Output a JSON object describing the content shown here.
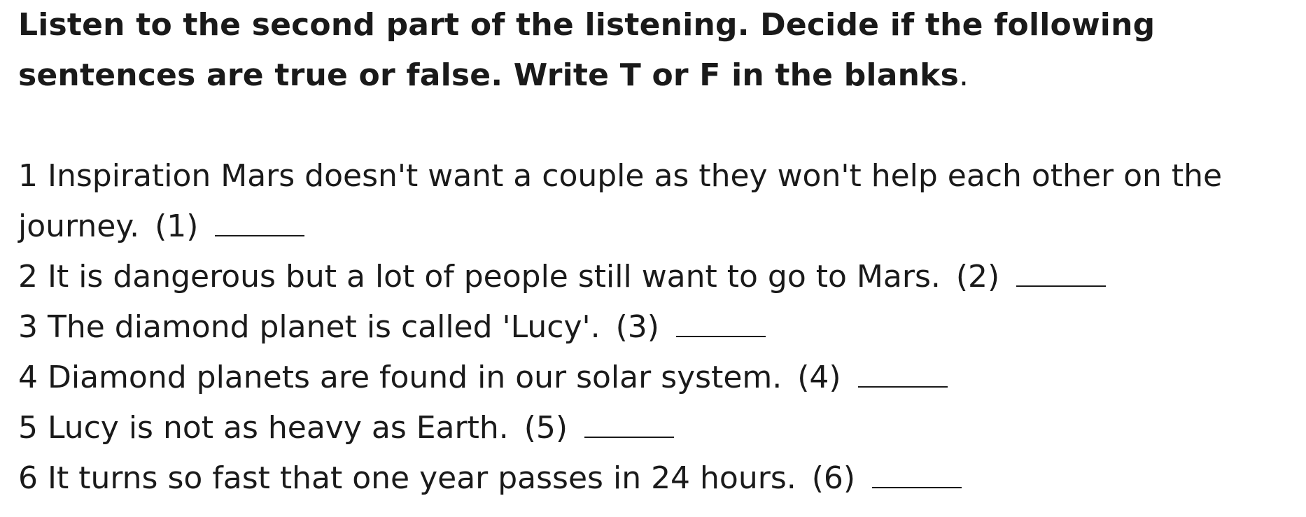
{
  "instructions": {
    "text": "Listen to the second part of the listening. Decide if the following sentences are true or false. Write T or F in the blanks",
    "end_punct": "."
  },
  "questions": [
    {
      "text": "1 Inspiration Mars doesn't want a couple as they won't help each other on the journey.",
      "number": "(1)",
      "answer": ""
    },
    {
      "text": "2 It is dangerous but a lot of people still want to go to Mars.",
      "number": "(2)",
      "answer": ""
    },
    {
      "text": "3 The diamond planet is called 'Lucy'.",
      "number": "(3)",
      "answer": ""
    },
    {
      "text": "4 Diamond planets are found in our solar system.",
      "number": "(4)",
      "answer": ""
    },
    {
      "text": "5 Lucy is not as heavy as Earth.",
      "number": "(5)",
      "answer": ""
    },
    {
      "text": "6 It turns so fast that one year passes in 24 hours.",
      "number": "(6)",
      "answer": ""
    }
  ]
}
